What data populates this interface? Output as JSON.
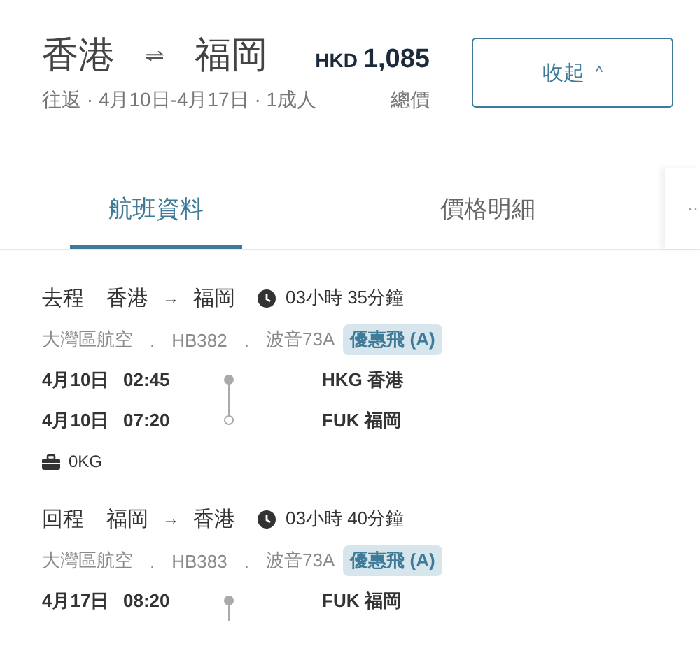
{
  "header": {
    "origin": "香港",
    "destination": "福岡",
    "currency": "HKD",
    "price": "1,085",
    "summary": "往返 · 4月10日-4月17日 · 1成人",
    "price_label": "總價",
    "collapse_button": "收起",
    "collapse_caret": "^"
  },
  "tabs": [
    {
      "label": "航班資料",
      "selected": true
    },
    {
      "label": "價格明細",
      "selected": false
    }
  ],
  "more_tabs": "··",
  "segments": [
    {
      "direction": "去程",
      "from": "香港",
      "arrow": "→",
      "to": "福岡",
      "duration": "03小時 35分鐘",
      "airline": "大灣區航空",
      "separator": ".",
      "flight": "HB382",
      "aircraft": "波音73A",
      "fare": "優惠飛 (A)",
      "stops": [
        {
          "kind": "departure",
          "date": "4月10日",
          "time": "02:45",
          "airport": "HKG 香港"
        },
        {
          "kind": "arrival",
          "date": "4月10日",
          "time": "07:20",
          "airport": "FUK 福岡"
        }
      ],
      "baggage": "0KG"
    },
    {
      "direction": "回程",
      "from": "福岡",
      "arrow": "→",
      "to": "香港",
      "duration": "03小時 40分鐘",
      "airline": "大灣區航空",
      "separator": ".",
      "flight": "HB383",
      "aircraft": "波音73A",
      "fare": "優惠飛 (A)",
      "stops": [
        {
          "kind": "departure",
          "date": "4月17日",
          "time": "08:20",
          "airport": "FUK 福岡"
        }
      ]
    }
  ]
}
